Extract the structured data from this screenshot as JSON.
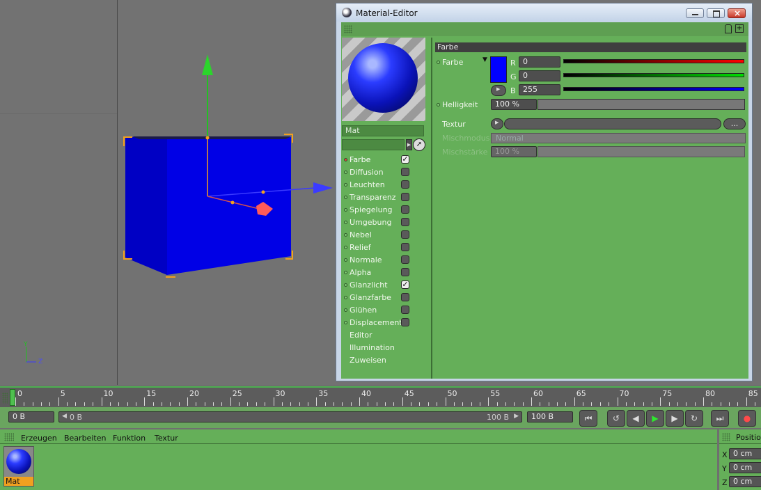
{
  "material_editor": {
    "title": "Material-Editor",
    "material_name": "Mat",
    "channels": [
      {
        "label": "Farbe",
        "checked": true,
        "selected": true,
        "has_checkbox": true
      },
      {
        "label": "Diffusion",
        "checked": false,
        "has_checkbox": true
      },
      {
        "label": "Leuchten",
        "checked": false,
        "has_checkbox": true
      },
      {
        "label": "Transparenz",
        "checked": false,
        "has_checkbox": true
      },
      {
        "label": "Spiegelung",
        "checked": false,
        "has_checkbox": true
      },
      {
        "label": "Umgebung",
        "checked": false,
        "has_checkbox": true
      },
      {
        "label": "Nebel",
        "checked": false,
        "has_checkbox": true
      },
      {
        "label": "Relief",
        "checked": false,
        "has_checkbox": true
      },
      {
        "label": "Normale",
        "checked": false,
        "has_checkbox": true
      },
      {
        "label": "Alpha",
        "checked": false,
        "has_checkbox": true
      },
      {
        "label": "Glanzlicht",
        "checked": true,
        "has_checkbox": true
      },
      {
        "label": "Glanzfarbe",
        "checked": false,
        "has_checkbox": true
      },
      {
        "label": "Glühen",
        "checked": false,
        "has_checkbox": true
      },
      {
        "label": "Displacement",
        "checked": false,
        "has_checkbox": true
      },
      {
        "label": "Editor",
        "has_checkbox": false
      },
      {
        "label": "Illumination",
        "has_checkbox": false
      },
      {
        "label": "Zuweisen",
        "has_checkbox": false
      }
    ],
    "section_header": "Farbe",
    "color_label": "Farbe",
    "color_swatch": "#0000ff",
    "r_label": "R",
    "r_value": "0",
    "g_label": "G",
    "g_value": "0",
    "b_label": "B",
    "b_value": "255",
    "brightness_label": "Helligkeit",
    "brightness_value": "100 %",
    "texture_label": "Textur",
    "texture_button": "...",
    "mix_mode_label": "Mischmodus",
    "mix_mode_value": "Normal",
    "mix_strength_label": "Mischstärke",
    "mix_strength_value": "100 %"
  },
  "viewport": {
    "axis_y": "Y",
    "axis_z": "Z",
    "object_color": "#0000ff"
  },
  "timeline": {
    "ticks": [
      "0",
      "5",
      "10",
      "15",
      "20",
      "25",
      "30",
      "35",
      "40",
      "45",
      "50",
      "55",
      "60",
      "65",
      "70",
      "75",
      "80",
      "85"
    ]
  },
  "transport": {
    "current_frame": "0 B",
    "range_start": "0 B",
    "range_end": "100 B",
    "end_frame": "100 B"
  },
  "material_manager": {
    "menu": [
      "Erzeugen",
      "Bearbeiten",
      "Funktion",
      "Textur"
    ],
    "material_label": "Mat"
  },
  "coordinates": {
    "title": "Position",
    "rows": [
      {
        "axis": "X",
        "value": "0 cm"
      },
      {
        "axis": "Y",
        "value": "0 cm"
      },
      {
        "axis": "Z",
        "value": "0 cm"
      }
    ]
  }
}
